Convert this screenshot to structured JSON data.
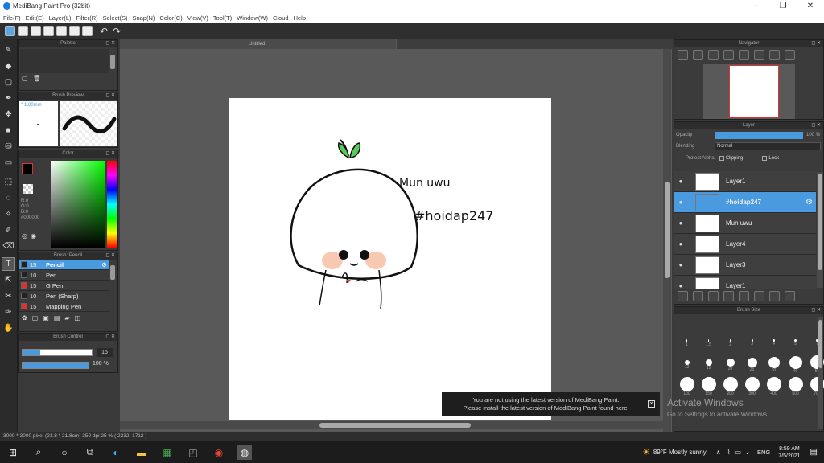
{
  "window": {
    "title": "MediBang Paint Pro (32bit)",
    "minimize": "–",
    "maximize": "❐",
    "close": "✕"
  },
  "menu": [
    "File(F)",
    "Edit(E)",
    "Layer(L)",
    "Filter(R)",
    "Select(S)",
    "Snap(N)",
    "Color(C)",
    "View(V)",
    "Tool(T)",
    "Window(W)",
    "Cloud",
    "Help"
  ],
  "panels": {
    "palette": "Palette",
    "brush_preview": "Brush Preview",
    "brush_preview_size": "* 1.00mm",
    "color": "Color",
    "color_values": {
      "r": "R:0",
      "g": "G:0",
      "b": "B:0",
      "hex": "#000000"
    },
    "brush_list_title": "Brush: Pencil",
    "brush_control": "Brush Control",
    "brush_size_value": "15",
    "brush_opacity_value": "100 %",
    "navigator": "Navigator",
    "layer": "Layer",
    "brush_size": "Brush Size"
  },
  "brushes": [
    {
      "size": "15",
      "name": "Pencil",
      "color": "#4a9ae0"
    },
    {
      "size": "10",
      "name": "Pen",
      "color": "#222222"
    },
    {
      "size": "15",
      "name": "G Pen",
      "color": "#e03030"
    },
    {
      "size": "10",
      "name": "Pen (Sharp)",
      "color": "#222222"
    },
    {
      "size": "15",
      "name": "Mapping Pen",
      "color": "#e03030"
    }
  ],
  "layer_panel": {
    "opacity_label": "Opacity",
    "opacity_value": "100 %",
    "opacity_fraction": 1.0,
    "blending_label": "Blending",
    "blending_value": "Normal",
    "protect_alpha": "Protect Alpha",
    "clipping": "Clipping",
    "lock": "Lock",
    "layers": [
      {
        "name": "Layer1",
        "selected": false
      },
      {
        "name": "#hoidap247",
        "selected": true
      },
      {
        "name": "Mun uwu",
        "selected": false
      },
      {
        "name": "Layer4",
        "selected": false
      },
      {
        "name": "Layer3",
        "selected": false
      },
      {
        "name": "Layer1",
        "selected": false
      }
    ]
  },
  "brush_sizes": [
    "1",
    "1.5",
    "2",
    "3",
    "4",
    "5",
    "7",
    "12",
    "15",
    "20",
    "25",
    "30",
    "40",
    "50",
    "100",
    "150",
    "200",
    "300",
    "400",
    "500",
    "700"
  ],
  "document": {
    "tab": "Untitled"
  },
  "canvas_text": {
    "mun": "Mun uwu",
    "hashtag": "#hoidap247"
  },
  "status": "3000 * 3000 pixel  (21.8 * 21.8cm)  350 dpi  25 %  ( 2232, 1712 )",
  "notification": {
    "line1": "You are not using the latest version of MediBang Paint.",
    "line2": "Please install the latest version of MediBang Paint found here."
  },
  "watermark": {
    "title": "Activate Windows",
    "sub": "Go to Settings to activate Windows."
  },
  "taskbar": {
    "weather": "89°F  Mostly sunny",
    "lang": "ENG",
    "time": "8:59 AM",
    "date": "7/5/2021"
  }
}
